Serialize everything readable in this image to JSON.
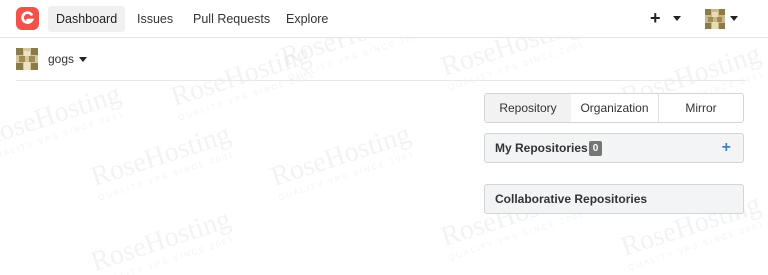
{
  "navbar": {
    "logo_icon": "gogs-logo-icon",
    "items": [
      {
        "label": "Dashboard",
        "active": true
      },
      {
        "label": "Issues",
        "active": false
      },
      {
        "label": "Pull Requests",
        "active": false
      },
      {
        "label": "Explore",
        "active": false
      }
    ],
    "create_label": "+",
    "user_avatar_icon": "user-avatar-icon"
  },
  "context": {
    "user": "gogs",
    "avatar_icon": "user-avatar-icon"
  },
  "repo_tabs": [
    {
      "label": "Repository",
      "active": true
    },
    {
      "label": "Organization",
      "active": false
    },
    {
      "label": "Mirror",
      "active": false
    }
  ],
  "my_repositories": {
    "title": "My Repositories",
    "count": "0",
    "add_label": "+"
  },
  "collaborative": {
    "title": "Collaborative Repositories"
  },
  "watermark": {
    "brand": "RoseHosting",
    "tagline": "QUALITY VPS SINCE 2001"
  },
  "colors": {
    "logo_red": "#f0524c",
    "accent_blue": "#4183c4",
    "badge_gray": "#767676",
    "panel_header": "#f3f4f5"
  }
}
